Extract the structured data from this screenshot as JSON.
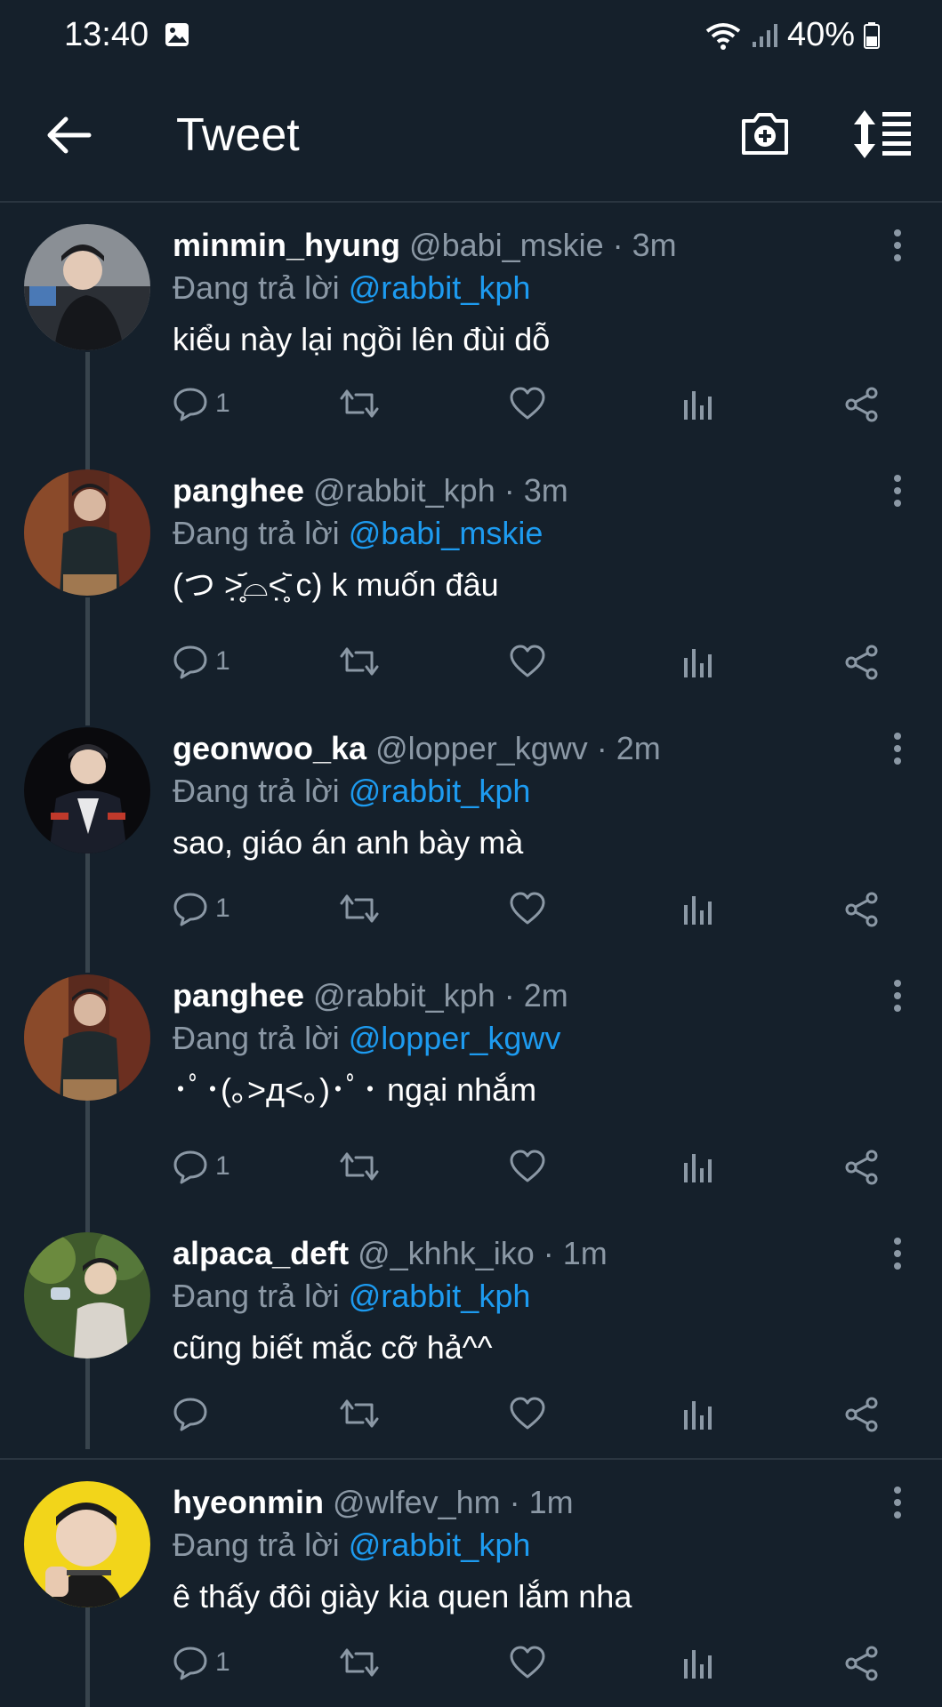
{
  "status_bar": {
    "time": "13:40",
    "battery": "40%"
  },
  "app_bar": {
    "title": "Tweet"
  },
  "reply_prefix": "Đang trả lời",
  "tweets": [
    {
      "username": "minmin_hyung",
      "handle": "@babi_mskie · 3m",
      "reply_to": "@rabbit_kph",
      "text": "kiểu này lại ngồi lên đùi dỗ",
      "reply_count": "1"
    },
    {
      "username": "panghee",
      "handle": "@rabbit_kph · 3m",
      "reply_to": "@babi_mskie",
      "text": "(つ ˃̣̣̥᷄⌓˂̣̣̥᷅ c) k muốn đâu",
      "reply_count": "1"
    },
    {
      "username": "geonwoo_ka",
      "handle": "@lopper_kgwv · 2m",
      "reply_to": "@rabbit_kph",
      "text": "sao, giáo án anh bày mà",
      "reply_count": "1"
    },
    {
      "username": "panghee",
      "handle": "@rabbit_kph · 2m",
      "reply_to": "@lopper_kgwv",
      "text": "･ﾟ･(｡>д<｡)･ﾟ･ ngại nhắm",
      "reply_count": "1"
    },
    {
      "username": "alpaca_deft",
      "handle": "@_khhk_iko · 1m",
      "reply_to": "@rabbit_kph",
      "text": "cũng biết mắc cỡ hả^^",
      "reply_count": ""
    },
    {
      "username": "hyeonmin",
      "handle": "@wlfev_hm · 1m",
      "reply_to": "@rabbit_kph",
      "text": "ê thấy đôi giày kia quen lắm nha",
      "reply_count": "1"
    }
  ],
  "colors": {
    "background": "#15202b",
    "link": "#1d9bf0",
    "muted": "#8b98a5"
  },
  "icons": [
    "back-arrow-icon",
    "camera-add-icon",
    "sort-icon",
    "reply-icon",
    "retweet-icon",
    "like-icon",
    "stats-icon",
    "share-icon",
    "more-icon"
  ]
}
